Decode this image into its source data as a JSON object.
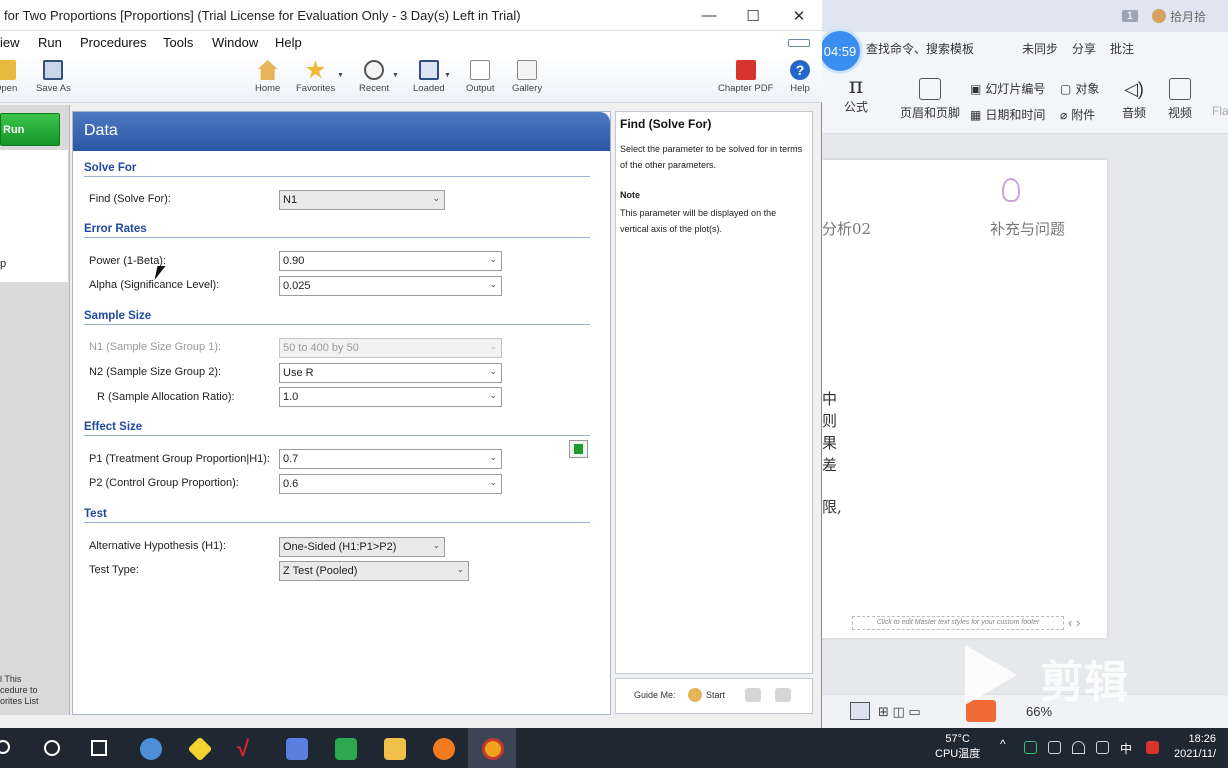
{
  "pass": {
    "title": "for Two Proportions [Proportions] (Trial License for Evaluation Only - 3 Day(s) Left in Trial)",
    "controls": {
      "minimize": "—",
      "maximize": "☐",
      "close": "✕"
    },
    "menu": [
      "iew",
      "Run",
      "Procedures",
      "Tools",
      "Window",
      "Help"
    ],
    "toolbar": {
      "open": "Open",
      "save_as": "Save As",
      "home": "Home",
      "favorites": "Favorites",
      "recent": "Recent",
      "loaded": "Loaded",
      "output": "Output",
      "gallery": "Gallery",
      "chapter_pdf": "Chapter PDF",
      "help": "Help"
    },
    "left": {
      "run_label": "Run",
      "fragment": "p",
      "note": [
        "l This",
        "cedure to",
        "orites List"
      ]
    },
    "data_panel": {
      "header": "Data",
      "solve_for": {
        "section": "Solve For",
        "find_label": "Find (Solve For):",
        "find_value": "N1"
      },
      "error_rates": {
        "section": "Error Rates",
        "power_label": "Power (1-Beta):",
        "power_value": "0.90",
        "alpha_label": "Alpha (Significance Level):",
        "alpha_value": "0.025"
      },
      "sample_size": {
        "section": "Sample Size",
        "n1_label": "N1 (Sample Size Group 1):",
        "n1_value": "50 to 400 by 50",
        "n2_label": "N2 (Sample Size Group 2):",
        "n2_value": "Use R",
        "r_label": "R (Sample Allocation Ratio):",
        "r_value": "1.0"
      },
      "effect_size": {
        "section": "Effect Size",
        "p1_label": "P1 (Treatment Group Proportion|H1):",
        "p1_value": "0.7",
        "p2_label": "P2 (Control Group Proportion):",
        "p2_value": "0.6"
      },
      "test": {
        "section": "Test",
        "alt_label": "Alternative Hypothesis (H1):",
        "alt_value": "One-Sided (H1:P1>P2)",
        "type_label": "Test Type:",
        "type_value": "Z Test (Pooled)"
      }
    },
    "help_panel": {
      "title": "Find (Solve For)",
      "body": "Select the parameter to be solved for in terms of the other parameters.",
      "note_title": "Note",
      "note_body": "This parameter will be displayed on the vertical axis of the plot(s).",
      "guide_label": "Guide Me:",
      "start_label": "Start"
    }
  },
  "ppt": {
    "badge": "1",
    "user": "拾月拾",
    "countdown": "04:59",
    "search": "查找命令、搜索模板",
    "actions": [
      "未同步",
      "分享",
      "批注"
    ],
    "ribbon": {
      "formula": "公式",
      "header_footer": "页眉和页脚",
      "slide_number": "幻灯片编号",
      "object": "对象",
      "datetime": "日期和时间",
      "attachment": "附件",
      "audio": "音频",
      "video": "视频",
      "flash": "Fla"
    },
    "slide": {
      "left_title": "分析02",
      "right_title": "补充与问题",
      "chars": [
        "中",
        "则",
        "果",
        "差"
      ],
      "limit": "限,",
      "footer": "Click to edit Master text styles for your custom footer"
    },
    "zoom": "66%",
    "watermark": "剪辑"
  },
  "taskbar": {
    "temp": "57°C",
    "temp_label": "CPU温度",
    "ime": "中",
    "time": "18:26",
    "date": "2021/11/"
  }
}
